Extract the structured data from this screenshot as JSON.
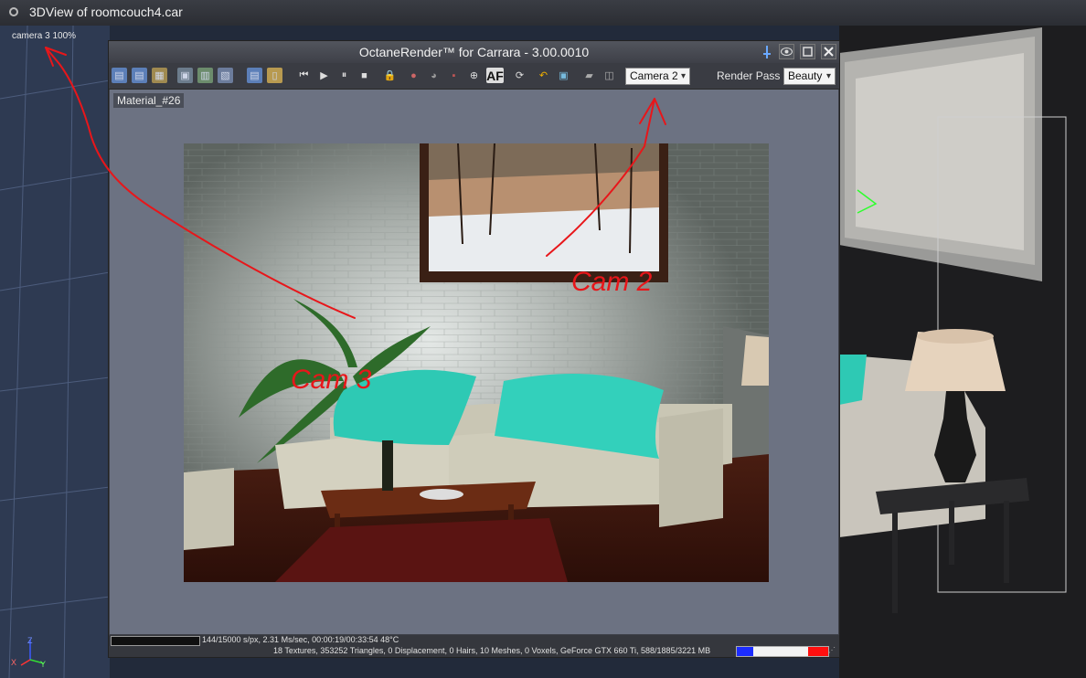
{
  "outer": {
    "title": "3DView of roomcouch4.car",
    "camera_label": "camera 3 100%",
    "axis": {
      "z": "Z",
      "x": "X",
      "y": "Y"
    }
  },
  "octane": {
    "title": "OctaneRender™ for Carrara - 3.00.0010",
    "toolbar": {
      "af_label": "AF",
      "camera_select": "Camera 2",
      "render_pass_label": "Render Pass",
      "render_pass_select": "Beauty"
    },
    "material_label": "Material_#26",
    "status": {
      "line1": "144/15000 s/px, 2.31 Ms/sec, 00:00:19/00:33:54    48°C",
      "line2": "18 Textures, 353252 Triangles, 0 Displacement, 0 Hairs, 10 Meshes, 0 Voxels, GeForce GTX 660 Ti, 588/1885/3221 MB"
    }
  },
  "annotations": {
    "cam2": "Cam 2",
    "cam3": "Cam 3"
  },
  "colors": {
    "annotation": "#e8161a",
    "pillow": "#2ec9b4",
    "memory_used": "#1c2cff",
    "memory_high": "#ff0f0f"
  }
}
